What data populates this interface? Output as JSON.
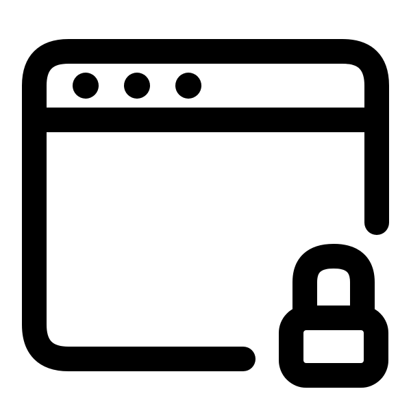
{
  "icon": {
    "name": "browser-window-lock-icon",
    "parts": [
      "browser-window-frame",
      "window-control-dots",
      "padlock-icon"
    ],
    "stroke_color": "#000000",
    "background_color": "#ffffff"
  }
}
